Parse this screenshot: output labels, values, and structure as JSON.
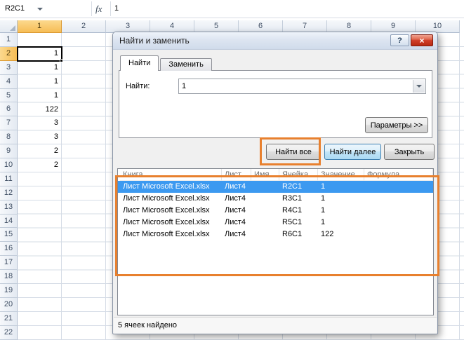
{
  "colors": {
    "annotation": "#e8802e",
    "selected_result_row": "#3c99f0",
    "selected_header": "#f6bd55"
  },
  "formula_bar": {
    "name_box_value": "R2C1",
    "fx_label": "fx",
    "formula_value": "1"
  },
  "grid": {
    "selected_cell": "R2C1",
    "selected_column": "1",
    "selected_row": "2",
    "columns": [
      "1",
      "2",
      "3",
      "4",
      "5",
      "6",
      "7",
      "8",
      "9",
      "10"
    ],
    "rows": [
      "1",
      "2",
      "3",
      "4",
      "5",
      "6",
      "7",
      "8",
      "9",
      "10",
      "11",
      "12",
      "13",
      "14",
      "15",
      "16",
      "17",
      "18",
      "19",
      "20",
      "21",
      "22"
    ],
    "cells": [
      {
        "row": 2,
        "col": 1,
        "value": "1"
      },
      {
        "row": 3,
        "col": 1,
        "value": "1"
      },
      {
        "row": 4,
        "col": 1,
        "value": "1"
      },
      {
        "row": 5,
        "col": 1,
        "value": "1"
      },
      {
        "row": 6,
        "col": 1,
        "value": "122"
      },
      {
        "row": 7,
        "col": 1,
        "value": "3"
      },
      {
        "row": 8,
        "col": 1,
        "value": "3"
      },
      {
        "row": 9,
        "col": 1,
        "value": "2"
      },
      {
        "row": 10,
        "col": 1,
        "value": "2"
      }
    ]
  },
  "dialog": {
    "title": "Найти и заменить",
    "window_buttons": {
      "help": "?",
      "close": "×"
    },
    "tabs": [
      {
        "label": "Найти"
      },
      {
        "label": "Заменить"
      }
    ],
    "find_label": "Найти:",
    "find_value": "1",
    "options_button": "Параметры >>",
    "buttons": {
      "find_all": "Найти все",
      "find_next": "Найти далее",
      "close": "Закрыть"
    },
    "results": {
      "headers": [
        "Книга",
        "Лист",
        "Имя",
        "Ячейка",
        "Значение",
        "Формула"
      ],
      "selected_index": 0,
      "rows": [
        {
          "book": "Лист Microsoft Excel.xlsx",
          "sheet": "Лист4",
          "name": "",
          "cell": "R2C1",
          "value": "1",
          "formula": ""
        },
        {
          "book": "Лист Microsoft Excel.xlsx",
          "sheet": "Лист4",
          "name": "",
          "cell": "R3C1",
          "value": "1",
          "formula": ""
        },
        {
          "book": "Лист Microsoft Excel.xlsx",
          "sheet": "Лист4",
          "name": "",
          "cell": "R4C1",
          "value": "1",
          "formula": ""
        },
        {
          "book": "Лист Microsoft Excel.xlsx",
          "sheet": "Лист4",
          "name": "",
          "cell": "R5C1",
          "value": "1",
          "formula": ""
        },
        {
          "book": "Лист Microsoft Excel.xlsx",
          "sheet": "Лист4",
          "name": "",
          "cell": "R6C1",
          "value": "122",
          "formula": ""
        }
      ]
    },
    "status": "5 ячеек найдено"
  }
}
